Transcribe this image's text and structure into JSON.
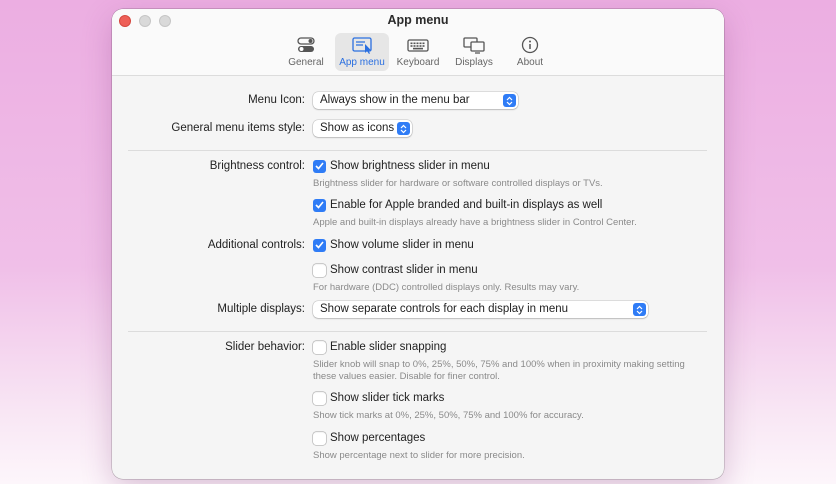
{
  "window": {
    "title": "App menu"
  },
  "toolbar": {
    "tabs": [
      {
        "label": "General",
        "icon": "toggle-icon",
        "active": false
      },
      {
        "label": "App menu",
        "icon": "menu-pointer-icon",
        "active": true
      },
      {
        "label": "Keyboard",
        "icon": "keyboard-icon",
        "active": false
      },
      {
        "label": "Displays",
        "icon": "displays-icon",
        "active": false
      },
      {
        "label": "About",
        "icon": "info-icon",
        "active": false
      }
    ]
  },
  "settings": {
    "menu_icon": {
      "label": "Menu Icon:",
      "value": "Always show in the menu bar"
    },
    "general_style": {
      "label": "General menu items style:",
      "value": "Show as icons"
    },
    "brightness": {
      "label": "Brightness control:",
      "show_slider": {
        "label": "Show brightness slider in menu",
        "checked": true,
        "desc": "Brightness slider for hardware or software controlled displays or TVs."
      },
      "apple_displays": {
        "label": "Enable for Apple branded and built-in displays as well",
        "checked": true,
        "desc": "Apple and built-in displays already have a brightness slider in Control Center."
      }
    },
    "additional": {
      "label": "Additional controls:",
      "volume": {
        "label": "Show volume slider in menu",
        "checked": true
      },
      "contrast": {
        "label": "Show contrast slider in menu",
        "checked": false,
        "desc": "For hardware (DDC) controlled displays only. Results may vary."
      }
    },
    "multiple_displays": {
      "label": "Multiple displays:",
      "value": "Show separate controls for each display in menu"
    },
    "slider": {
      "label": "Slider behavior:",
      "snapping": {
        "label": "Enable slider snapping",
        "checked": false,
        "desc_line1": "Slider knob will snap to 0%, 25%, 50%, 75% and 100% when in proximity making setting",
        "desc_line2": "these values easier. Disable for finer control."
      },
      "tick_marks": {
        "label": "Show slider tick marks",
        "checked": false,
        "desc": "Show tick marks at 0%, 25%, 50%, 75% and 100% for accuracy."
      },
      "percentages": {
        "label": "Show percentages",
        "checked": false,
        "desc": "Show percentage next to slider for more precision."
      }
    }
  },
  "colors": {
    "accent": "#2f7cf6",
    "close": "#ee5f57"
  }
}
